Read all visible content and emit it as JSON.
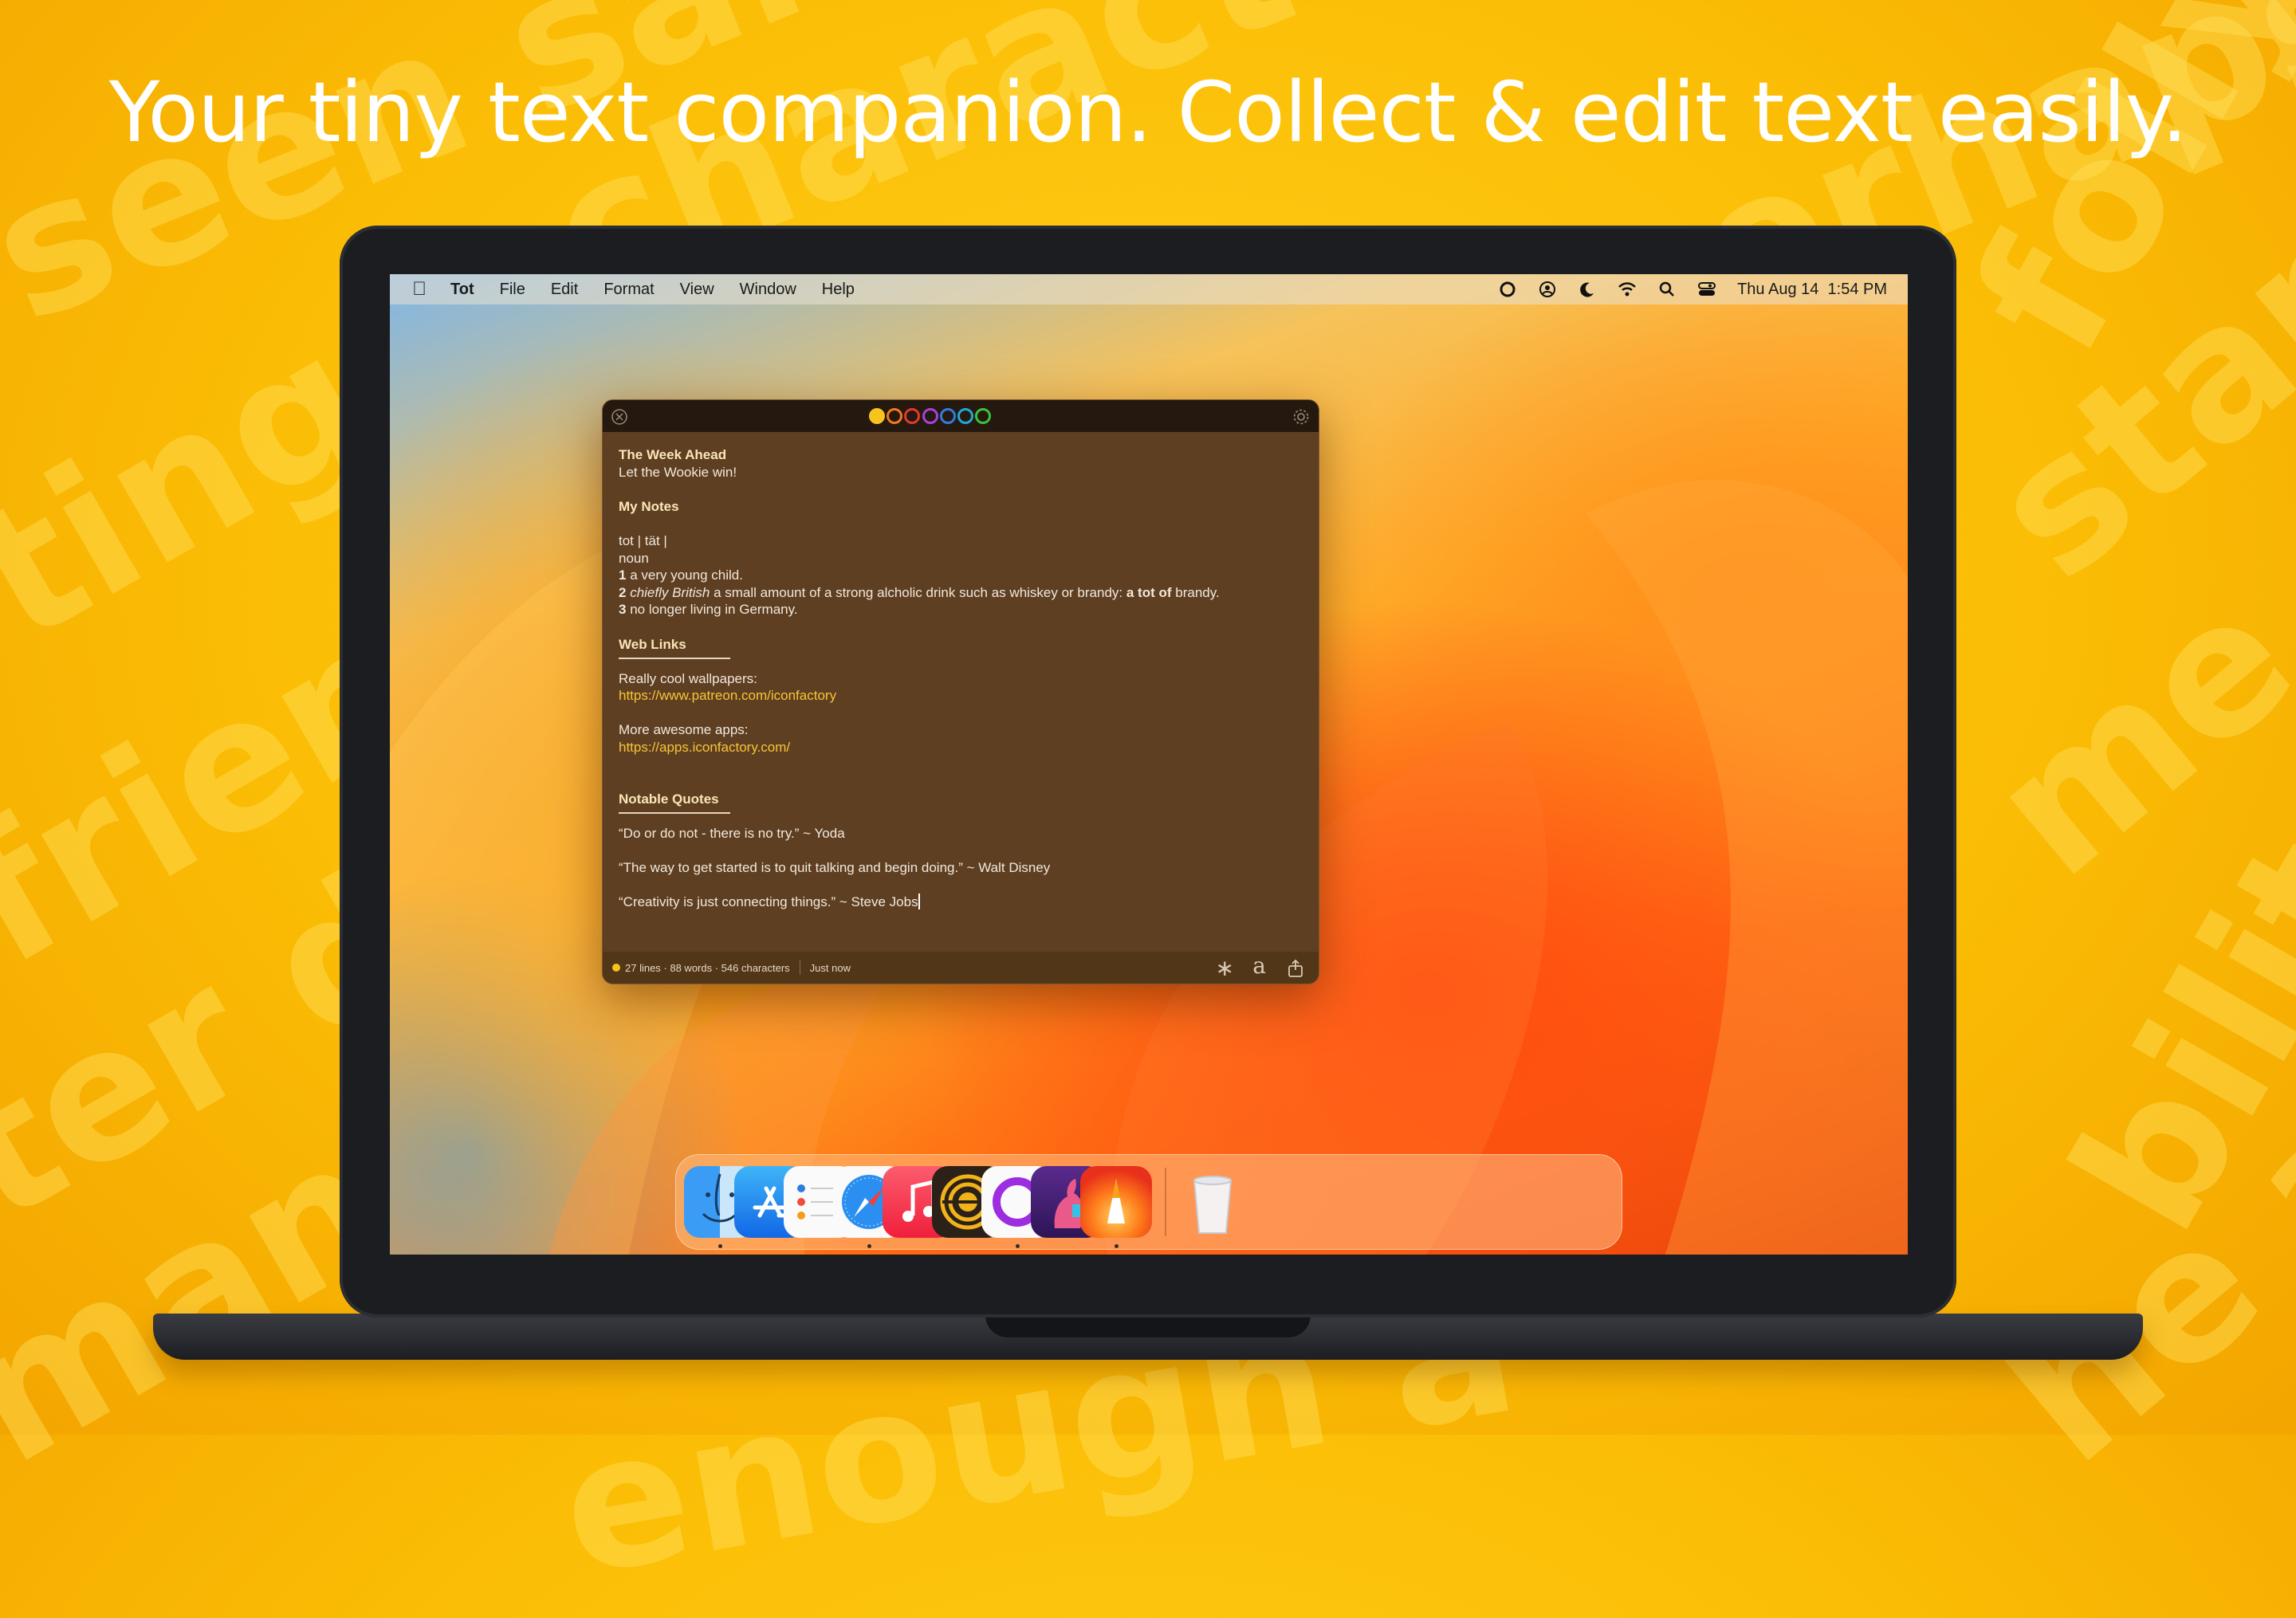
{
  "headline": "Your tiny text companion. Collect & edit text easily.",
  "menubar": {
    "apple": "",
    "app_name": "Tot",
    "menus": [
      "File",
      "Edit",
      "Format",
      "View",
      "Window",
      "Help"
    ],
    "status_icons": [
      "circle-icon",
      "user-icon",
      "moon-icon",
      "wifi-icon",
      "search-icon",
      "control-center-icon"
    ],
    "clock": "Thu Aug 14  1:54 PM"
  },
  "tot": {
    "color_dots": [
      {
        "color": "#f7c31d",
        "filled": true
      },
      {
        "color": "#f07a1e",
        "filled": false
      },
      {
        "color": "#e23a2e",
        "filled": false
      },
      {
        "color": "#a443d8",
        "filled": false
      },
      {
        "color": "#2f7de0",
        "filled": false
      },
      {
        "color": "#21a8d8",
        "filled": false
      },
      {
        "color": "#3cc23c",
        "filled": false
      }
    ],
    "note": {
      "h1": "The Week Ahead",
      "l1": "Let the Wookie win!",
      "h2": "My Notes",
      "d1": "tot | tät |",
      "d2": "noun",
      "d3n": "1",
      "d3": " a very young child.",
      "d4n": "2",
      "d4i": " chiefly British",
      "d4a": " a small amount of a strong alcholic drink such as whiskey or brandy: ",
      "d4b": "a tot of",
      "d4c": " brandy.",
      "d5n": "3",
      "d5": " no longer living in Germany.",
      "h3": "Web Links",
      "w1": "Really cool wallpapers:",
      "w1link": "https://www.patreon.com/iconfactory",
      "w2": "More awesome apps:",
      "w2link": "https://apps.iconfactory.com/",
      "h4": "Notable Quotes",
      "q1": "“Do or do not - there is no try.” ~ Yoda",
      "q2": "“The way to get started is to quit talking and begin doing.” ~ Walt Disney",
      "q3": "“Creativity is just connecting things.” ~ Steve Jobs"
    },
    "footer": {
      "stats": "27 lines · 88 words · 546 characters",
      "saved": "Just now",
      "asterisk": "∗",
      "font_letter": "a"
    }
  },
  "dock": {
    "apps": [
      "Finder",
      "App Store",
      "Reminders",
      "Safari",
      "Music",
      "Tapestry",
      "Tot",
      "Wallaroo",
      "Linea"
    ],
    "trash": "Trash"
  }
}
